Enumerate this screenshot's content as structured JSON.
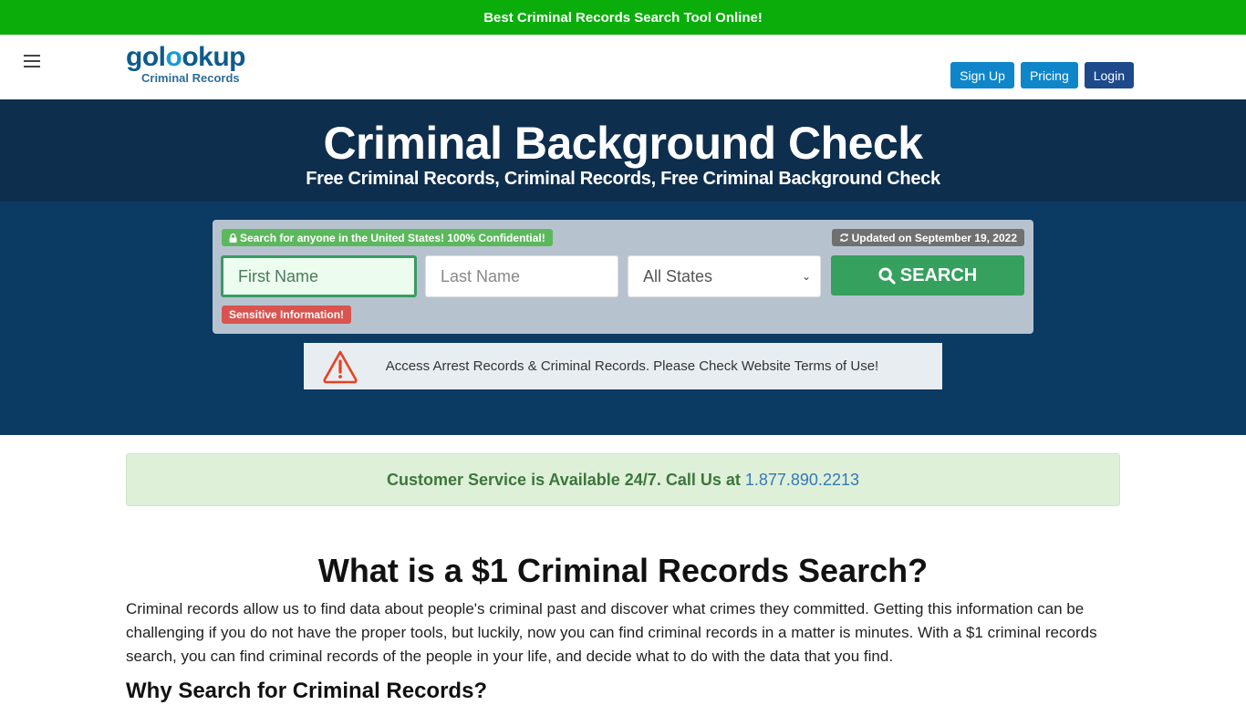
{
  "topbar": {
    "text": "Best Criminal Records Search Tool Online!"
  },
  "header": {
    "menu_icon": "hamburger-icon",
    "logo": {
      "brand_part1": "gol",
      "brand_part2": "o",
      "brand_part3": "okup",
      "subtitle": "Criminal Records"
    },
    "nav": {
      "signup": "Sign Up",
      "pricing": "Pricing",
      "login": "Login"
    }
  },
  "hero": {
    "title": "Criminal Background Check",
    "subtitle": "Free Criminal Records, Criminal Records, Free Criminal Background Check"
  },
  "search": {
    "confidential_badge": "Search for anyone in the United States! 100% Confidential!",
    "updated_badge": "Updated on September 19, 2022",
    "first_name_placeholder": "First Name",
    "last_name_placeholder": "Last Name",
    "state_selected": "All States",
    "search_button": "SEARCH",
    "sensitive_badge": "Sensitive Information!",
    "colors": {
      "accent_green": "#36a05f",
      "badge_green": "#5cb85c",
      "badge_red": "#d9534f"
    }
  },
  "notice": {
    "icon": "warning-icon",
    "text": "Access Arrest Records & Criminal Records. Please Check Website Terms of Use!"
  },
  "customer_service": {
    "text": "Customer Service is Available 24/7. Call Us at",
    "phone": "1.877.890.2213"
  },
  "article": {
    "heading": "What is a $1 Criminal Records Search?",
    "paragraph": "Criminal records allow us to find data about people's criminal past and discover what crimes they committed. Getting this information can be challenging if you do not have the proper tools, but luckily, now you can find criminal records in a matter is minutes. With a $1 criminal records search, you can find criminal records of the people in your life, and decide what to do with the data that you find.",
    "subheading": "Why Search for Criminal Records?"
  }
}
